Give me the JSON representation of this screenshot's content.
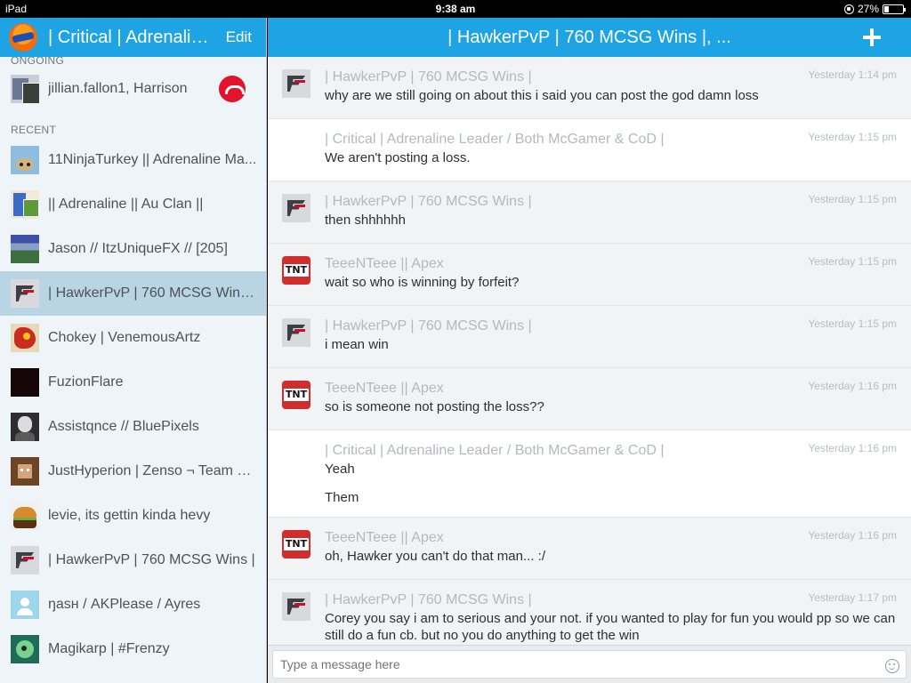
{
  "status_bar": {
    "device": "iPad",
    "time": "9:38 am",
    "battery": "27%",
    "battery_level": 0.27
  },
  "sidebar": {
    "title": "| Critical | Adrenaline Leader / Both McGamer & CoD |",
    "edit_label": "Edit",
    "ongoing_label": "ONGOING",
    "recent_label": "RECENT",
    "ongoing": [
      {
        "name": "jillian.fallon1, Harrison",
        "thumb": "group-avatar"
      }
    ],
    "recent": [
      {
        "name": "11NinjaTurkey || Adrenaline Ma...",
        "thumb": "turkey-avatar"
      },
      {
        "name": "|| Adrenaline || Au Clan ||",
        "thumb": "clan-avatar"
      },
      {
        "name": "Jason // ItzUniqueFX // [205]",
        "thumb": "jason-avatar"
      },
      {
        "name": "| HawkerPvP | 760 MCSG Wins...",
        "thumb": "faze-avatar",
        "active": true
      },
      {
        "name": "Chokey | VenemousArtz",
        "thumb": "chokey-avatar"
      },
      {
        "name": "FuzionFlare",
        "thumb": "fuzion-avatar"
      },
      {
        "name": "Assistqnce // BluePixels",
        "thumb": "assist-avatar"
      },
      {
        "name": "JustHyperion | Zenso ¬ Team E...",
        "thumb": "hyperion-avatar"
      },
      {
        "name": "levie, its gettin kinda hevy",
        "thumb": "burger-avatar"
      },
      {
        "name": "| HawkerPvP | 760 MCSG Wins |",
        "thumb": "faze-avatar"
      },
      {
        "name": "ŋasн / AKPlease / Ayres",
        "thumb": "default-avatar"
      },
      {
        "name": "Magikarp | #Frenzy",
        "thumb": "magikarp-avatar"
      }
    ]
  },
  "chat": {
    "title": "| HawkerPvP | 760 MCSG Wins |, ...",
    "composer_placeholder": "Type a message here",
    "messages": [
      {
        "author": "| HawkerPvP | 760 MCSG Wins |",
        "time": "Yesterday 1:14 pm",
        "text": "why are we still going on about this i said you can post the god damn loss",
        "avatar": "faze"
      },
      {
        "author": "| Critical | Adrenaline Leader / Both McGamer & CoD |",
        "time": "Yesterday 1:15 pm",
        "text": "We aren't posting a loss.",
        "avatar": "none"
      },
      {
        "author": "| HawkerPvP | 760 MCSG Wins |",
        "time": "Yesterday 1:15 pm",
        "text": "then shhhhhh",
        "avatar": "faze"
      },
      {
        "author": "TeeeNTeee || Apex",
        "time": "Yesterday 1:15 pm",
        "text": "wait so who is winning by forfeit?",
        "avatar": "tnt"
      },
      {
        "author": "| HawkerPvP | 760 MCSG Wins |",
        "time": "Yesterday 1:15 pm",
        "text": "i mean win",
        "avatar": "faze"
      },
      {
        "author": "TeeeNTeee || Apex",
        "time": "Yesterday 1:16 pm",
        "text": "so is someone not posting the loss??",
        "avatar": "tnt"
      },
      {
        "author": "| Critical | Adrenaline Leader / Both McGamer & CoD |",
        "time": "Yesterday 1:16 pm",
        "text": "Yeah",
        "text2": "Them",
        "avatar": "none"
      },
      {
        "author": "TeeeNTeee || Apex",
        "time": "Yesterday 1:16 pm",
        "text": "oh, Hawker you can't do that man... :/",
        "avatar": "tnt"
      },
      {
        "author": "| HawkerPvP | 760 MCSG Wins |",
        "time": "Yesterday 1:17 pm",
        "text": "Corey you say i am to serious and your not. if you wanted to play for fun you would pp so we can still do a fun cb. but no you do anything to get the win",
        "avatar": "faze"
      }
    ]
  }
}
